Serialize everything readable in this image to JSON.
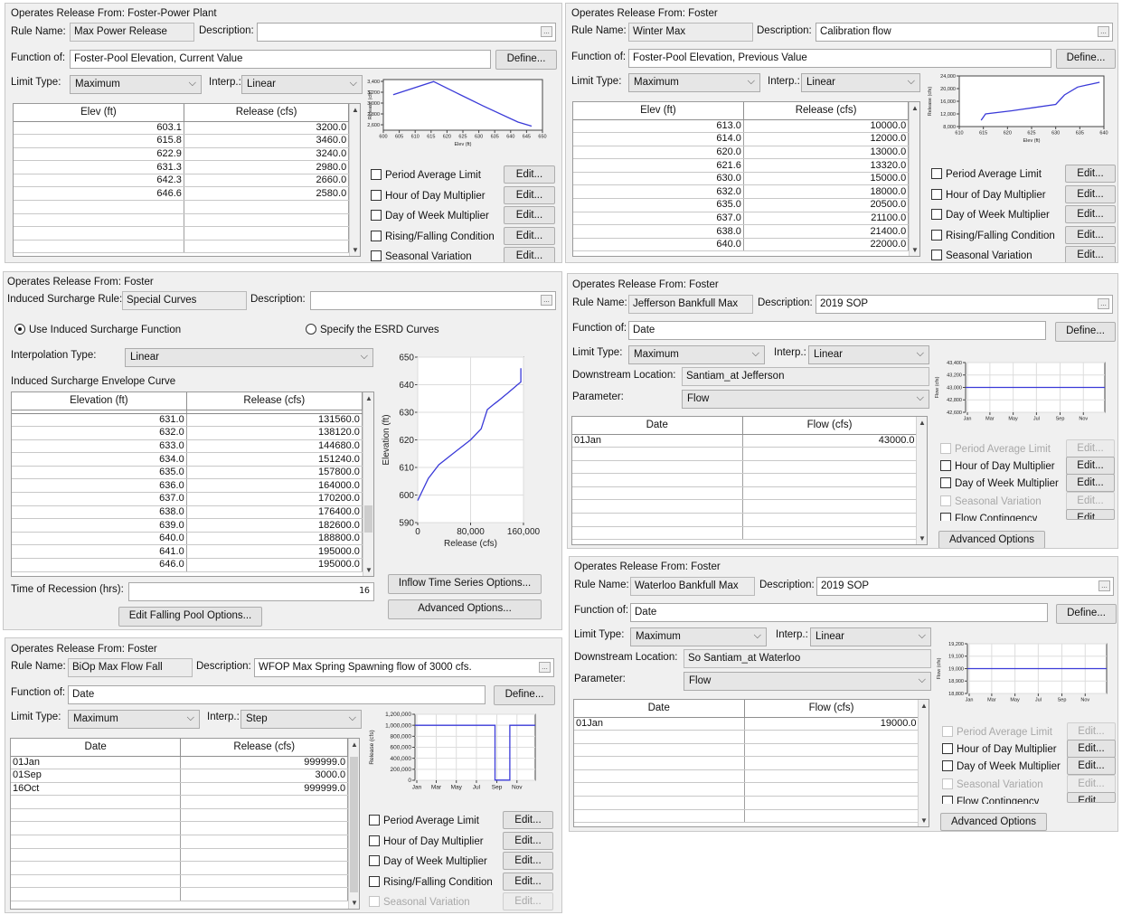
{
  "p1": {
    "header": "Operates Release From: Foster-Power Plant",
    "rule_label": "Rule Name:",
    "rule": "Max Power Release",
    "desc_label": "Description:",
    "desc": "",
    "func_label": "Function of:",
    "func": "Foster-Pool Elevation, Current Value",
    "define": "Define...",
    "limit_label": "Limit Type:",
    "limit": "Maximum",
    "interp_label": "Interp.:",
    "interp": "Linear",
    "col1": "Elev (ft)",
    "col2": "Release (cfs)",
    "rows": [
      [
        "603.1",
        "3200.0"
      ],
      [
        "615.8",
        "3460.0"
      ],
      [
        "622.9",
        "3240.0"
      ],
      [
        "631.3",
        "2980.0"
      ],
      [
        "642.3",
        "2660.0"
      ],
      [
        "646.6",
        "2580.0"
      ]
    ],
    "options": [
      {
        "label": "Period Average Limit",
        "btn": "Edit..."
      },
      {
        "label": "Hour of Day Multiplier",
        "btn": "Edit..."
      },
      {
        "label": "Day of Week Multiplier",
        "btn": "Edit..."
      },
      {
        "label": "Rising/Falling Condition",
        "btn": "Edit..."
      },
      {
        "label": "Seasonal Variation",
        "btn": "Edit..."
      }
    ]
  },
  "p2": {
    "header": "Operates Release From: Foster",
    "rule_label": "Rule Name:",
    "rule": "Winter Max",
    "desc_label": "Description:",
    "desc": "Calibration flow",
    "func_label": "Function of:",
    "func": "Foster-Pool Elevation, Previous Value",
    "define": "Define...",
    "limit_label": "Limit Type:",
    "limit": "Maximum",
    "interp_label": "Interp.:",
    "interp": "Linear",
    "col1": "Elev (ft)",
    "col2": "Release (cfs)",
    "rows": [
      [
        "613.0",
        "10000.0"
      ],
      [
        "614.0",
        "12000.0"
      ],
      [
        "620.0",
        "13000.0"
      ],
      [
        "621.6",
        "13320.0"
      ],
      [
        "630.0",
        "15000.0"
      ],
      [
        "632.0",
        "18000.0"
      ],
      [
        "635.0",
        "20500.0"
      ],
      [
        "637.0",
        "21100.0"
      ],
      [
        "638.0",
        "21400.0"
      ],
      [
        "640.0",
        "22000.0"
      ]
    ],
    "options": [
      {
        "label": "Period Average Limit",
        "btn": "Edit..."
      },
      {
        "label": "Hour of Day Multiplier",
        "btn": "Edit..."
      },
      {
        "label": "Day of Week Multiplier",
        "btn": "Edit..."
      },
      {
        "label": "Rising/Falling Condition",
        "btn": "Edit..."
      },
      {
        "label": "Seasonal Variation",
        "btn": "Edit..."
      }
    ]
  },
  "p3": {
    "header": "Operates Release From: Foster",
    "rule_label": "Induced Surcharge Rule:",
    "rule": "Special Curves",
    "desc_label": "Description:",
    "desc": "",
    "radio1": "Use Induced Surcharge Function",
    "radio2": "Specify the ESRD Curves",
    "interp_label": "Interpolation Type:",
    "interp": "Linear",
    "envelope": "Induced Surcharge Envelope Curve",
    "col1": "Elevation (ft)",
    "col2": "Release (cfs)",
    "rows": [
      [
        "631.0",
        "131560.0"
      ],
      [
        "632.0",
        "138120.0"
      ],
      [
        "633.0",
        "144680.0"
      ],
      [
        "634.0",
        "151240.0"
      ],
      [
        "635.0",
        "157800.0"
      ],
      [
        "636.0",
        "164000.0"
      ],
      [
        "637.0",
        "170200.0"
      ],
      [
        "638.0",
        "176400.0"
      ],
      [
        "639.0",
        "182600.0"
      ],
      [
        "640.0",
        "188800.0"
      ],
      [
        "641.0",
        "195000.0"
      ],
      [
        "646.0",
        "195000.0"
      ]
    ],
    "recession_label": "Time of Recession (hrs):",
    "recession": "16",
    "falling_btn": "Edit Falling Pool Options...",
    "inflow_btn": "Inflow Time Series Options...",
    "advanced_btn": "Advanced Options..."
  },
  "p4": {
    "header": "Operates Release From: Foster",
    "rule_label": "Rule Name:",
    "rule": "BiOp Max Flow Fall",
    "desc_label": "Description:",
    "desc": "WFOP Max Spring Spawning flow of 3000 cfs.",
    "func_label": "Function of:",
    "func": "Date",
    "define": "Define...",
    "limit_label": "Limit Type:",
    "limit": "Maximum",
    "interp_label": "Interp.:",
    "interp": "Step",
    "col1": "Date",
    "col2": "Release (cfs)",
    "rows": [
      [
        "01Jan",
        "999999.0"
      ],
      [
        "01Sep",
        "3000.0"
      ],
      [
        "16Oct",
        "999999.0"
      ]
    ],
    "options": [
      {
        "label": "Period Average Limit",
        "btn": "Edit..."
      },
      {
        "label": "Hour of Day Multiplier",
        "btn": "Edit..."
      },
      {
        "label": "Day of Week Multiplier",
        "btn": "Edit..."
      },
      {
        "label": "Rising/Falling Condition",
        "btn": "Edit..."
      },
      {
        "label": "Seasonal Variation",
        "btn": "Edit..."
      }
    ]
  },
  "p5": {
    "header": "Operates Release From: Foster",
    "rule_label": "Rule Name:",
    "rule": "Jefferson Bankfull Max",
    "desc_label": "Description:",
    "desc": "2019 SOP",
    "func_label": "Function of:",
    "func": "Date",
    "define": "Define...",
    "limit_label": "Limit Type:",
    "limit": "Maximum",
    "interp_label": "Interp.:",
    "interp": "Linear",
    "loc_label": "Downstream Location:",
    "loc": "Santiam_at Jefferson",
    "param_label": "Parameter:",
    "param": "Flow",
    "col1": "Date",
    "col2": "Flow (cfs)",
    "rows": [
      [
        "01Jan",
        "43000.0"
      ]
    ],
    "options": [
      {
        "label": "Period Average Limit",
        "btn": "Edit..."
      },
      {
        "label": "Hour of Day Multiplier",
        "btn": "Edit..."
      },
      {
        "label": "Day of Week Multiplier",
        "btn": "Edit..."
      },
      {
        "label": "Seasonal Variation",
        "btn": "Edit..."
      },
      {
        "label": "Flow Contingency",
        "btn": "Edit..."
      }
    ],
    "advanced_btn": "Advanced Options"
  },
  "p6": {
    "header": "Operates Release From: Foster",
    "rule_label": "Rule Name:",
    "rule": "Waterloo Bankfull Max",
    "desc_label": "Description:",
    "desc": "2019 SOP",
    "func_label": "Function of:",
    "func": "Date",
    "define": "Define...",
    "limit_label": "Limit Type:",
    "limit": "Maximum",
    "interp_label": "Interp.:",
    "interp": "Linear",
    "loc_label": "Downstream Location:",
    "loc": "So Santiam_at Waterloo",
    "param_label": "Parameter:",
    "param": "Flow",
    "col1": "Date",
    "col2": "Flow (cfs)",
    "rows": [
      [
        "01Jan",
        "19000.0"
      ]
    ],
    "options": [
      {
        "label": "Period Average Limit",
        "btn": "Edit..."
      },
      {
        "label": "Hour of Day Multiplier",
        "btn": "Edit..."
      },
      {
        "label": "Day of Week Multiplier",
        "btn": "Edit..."
      },
      {
        "label": "Seasonal Variation",
        "btn": "Edit..."
      },
      {
        "label": "Flow Contingency",
        "btn": "Edit..."
      }
    ],
    "advanced_btn": "Advanced Options"
  },
  "chart_data": [
    {
      "type": "line",
      "xlabel": "Elev (ft)",
      "ylabel": "Release (cfs)",
      "x": [
        603.1,
        615.8,
        622.9,
        631.3,
        642.3,
        646.6
      ],
      "y": [
        3200,
        3460,
        3240,
        2980,
        2660,
        2580
      ],
      "xlim": [
        600,
        650
      ],
      "ylim": [
        2500,
        3500
      ],
      "xticks": [
        "600",
        "605",
        "610",
        "615",
        "620",
        "625",
        "630",
        "635",
        "640",
        "645",
        "650"
      ],
      "yticks": [
        "3,400",
        "3,200",
        "3,000",
        "2,800",
        "2,600"
      ]
    },
    {
      "type": "line",
      "xlabel": "Elev (ft)",
      "ylabel": "Release (cfs)",
      "x": [
        613,
        614,
        620,
        621.6,
        630,
        632,
        635,
        637,
        638,
        640
      ],
      "y": [
        10000,
        12000,
        13000,
        13320,
        15000,
        18000,
        20500,
        21100,
        21400,
        22000
      ],
      "xlim": [
        608,
        641
      ],
      "ylim": [
        8000,
        24000
      ],
      "xticks": [
        "610",
        "615",
        "620",
        "625",
        "630",
        "635",
        "640"
      ],
      "yticks": [
        "24,000",
        "20,000",
        "16,000",
        "12,000",
        "8,000"
      ]
    },
    {
      "type": "line",
      "xlabel": "Release (cfs)",
      "ylabel": "Elevation (ft)",
      "x": [
        0,
        20000,
        40000,
        60000,
        80000,
        100000,
        120000,
        131560,
        138120,
        144680,
        151240,
        157800,
        164000,
        170200,
        176400,
        182600,
        188800,
        195000,
        195000
      ],
      "y": [
        598,
        606,
        611,
        614,
        617,
        620,
        624,
        631,
        632,
        633,
        634,
        635,
        636,
        637,
        638,
        639,
        640,
        641,
        646
      ],
      "xlim": [
        0,
        200000
      ],
      "ylim": [
        590,
        650
      ],
      "xticks": [
        "0",
        "80,000",
        "160,000"
      ],
      "yticks": [
        "650",
        "640",
        "630",
        "620",
        "610",
        "600",
        "590"
      ]
    },
    {
      "type": "line",
      "xlabel": "",
      "ylabel": "Release (cfs)",
      "categories": [
        "Jan",
        "Mar",
        "May",
        "Jul",
        "Sep",
        "Nov"
      ],
      "points": [
        [
          "01Jan",
          999999
        ],
        [
          "01Sep",
          3000
        ],
        [
          "16Oct",
          999999
        ]
      ],
      "ylim": [
        0,
        1200000
      ],
      "yticks": [
        "1,200,000",
        "1,000,000",
        "800,000",
        "600,000",
        "400,000",
        "200,000",
        "0"
      ]
    },
    {
      "type": "line",
      "xlabel": "",
      "ylabel": "Flow (cfs)",
      "categories": [
        "Jan",
        "Mar",
        "May",
        "Jul",
        "Sep",
        "Nov"
      ],
      "points": [
        [
          "01Jan",
          43000
        ]
      ],
      "ylim": [
        42500,
        43500
      ],
      "yticks": [
        "43,400",
        "43,200",
        "43,000",
        "42,800",
        "42,600"
      ]
    },
    {
      "type": "line",
      "xlabel": "",
      "ylabel": "Flow (cfs)",
      "categories": [
        "Jan",
        "Mar",
        "May",
        "Jul",
        "Sep",
        "Nov"
      ],
      "points": [
        [
          "01Jan",
          19000
        ]
      ],
      "ylim": [
        18750,
        19250
      ],
      "yticks": [
        "19,200",
        "19,100",
        "19,000",
        "18,900",
        "18,800"
      ]
    }
  ]
}
